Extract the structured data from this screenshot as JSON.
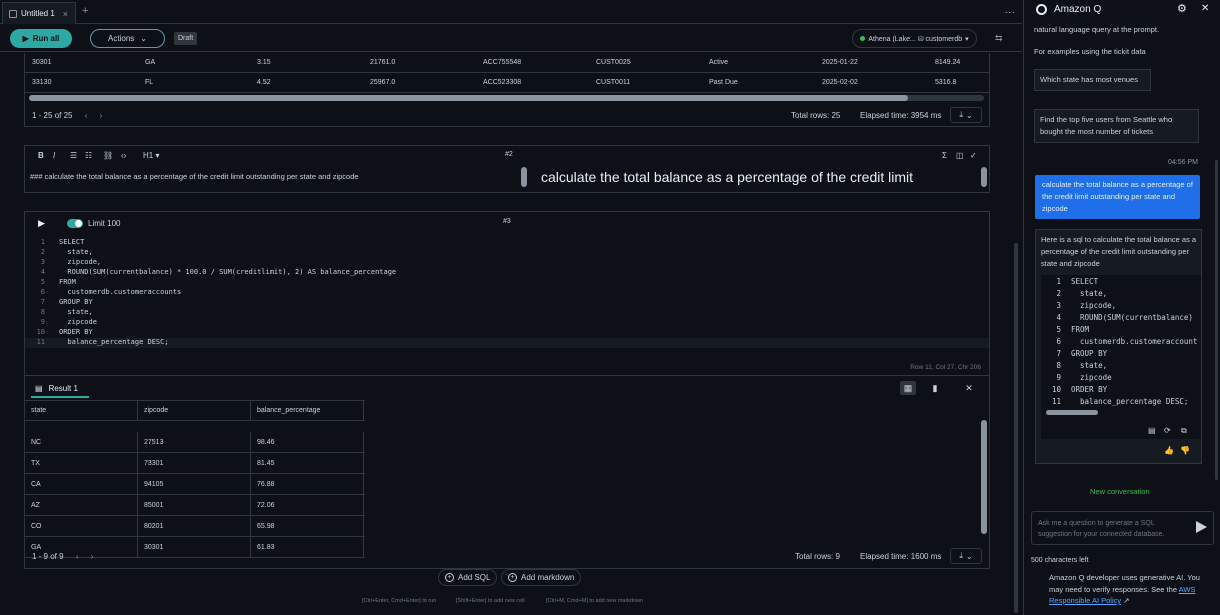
{
  "tab": {
    "title": "Untitled 1",
    "close": "×",
    "new": "+"
  },
  "window_menu": "...",
  "toolbar": {
    "run_all": "Run all",
    "actions": "Actions",
    "draft": "Draft",
    "db_label": "Athena (Lake... ⛁ customerdb",
    "collapse": "⇆"
  },
  "cell1": {
    "rows": [
      [
        "30301",
        "GA",
        "3.15",
        "21761.0",
        "ACC755548",
        "CUST0025",
        "Active",
        "2025-01-22",
        "8149.24"
      ],
      [
        "33130",
        "FL",
        "4.52",
        "25967.0",
        "ACC523308",
        "CUST0011",
        "Past Due",
        "2025-02-02",
        "5316.8"
      ]
    ],
    "pager": "1 - 25 of 25",
    "total_rows": "Total rows: 25",
    "elapsed": "Elapsed time: 3954 ms"
  },
  "cell2": {
    "toolbar": [
      "B",
      "I",
      "☰",
      "☷",
      "⛓",
      "‹›",
      "H1 ▾"
    ],
    "number": "#2",
    "right_tools": [
      "Σ",
      "◫",
      "✓"
    ],
    "source": "### calculate the total balance as a percentage of the credit limit outstanding per state and zipcode",
    "rendered": "calculate the total balance as a percentage of the credit limit"
  },
  "cell3": {
    "number": "#3",
    "limit": "Limit 100",
    "code": [
      "SELECT",
      "  state,",
      "  zipcode,",
      "  ROUND(SUM(currentbalance) * 100.0 / SUM(creditlimit), 2) AS balance_percentage",
      "FROM",
      "  customerdb.customeraccounts",
      "GROUP BY",
      "  state,",
      "  zipcode",
      "ORDER BY",
      "  balance_percentage DESC;"
    ],
    "cursor": "Row 11,  Col 27,  Chr 206",
    "result": {
      "tab": "Result 1",
      "columns": [
        "state",
        "zipcode",
        "balance_percentage"
      ],
      "rows": [
        [
          "NC",
          "27513",
          "98.46"
        ],
        [
          "TX",
          "73301",
          "81.45"
        ],
        [
          "CA",
          "94105",
          "76.88"
        ],
        [
          "AZ",
          "85001",
          "72.06"
        ],
        [
          "CO",
          "80201",
          "65.98"
        ],
        [
          "GA",
          "30301",
          "61.83"
        ]
      ],
      "pager": "1 - 9 of 9",
      "total_rows": "Total rows: 9",
      "elapsed": "Elapsed time: 1600 ms"
    }
  },
  "add": {
    "sql": "Add SQL",
    "markdown": "Add markdown"
  },
  "shortcuts": [
    "[Ctrl+Enter, Cmd+Enter] to run",
    "[Shift+Enter] to add new cell",
    "[Ctrl+M, Cmd+M] to add new markdown"
  ],
  "q": {
    "title": "Amazon Q",
    "top_text": "natural language query at the prompt.",
    "examples_label": "For examples using the tickit data",
    "suggestions": [
      "Which state has most venues",
      "Find the top five users from Seattle who bought the most number of tickets"
    ],
    "time": "04:56 PM",
    "user_msg": "calculate the total balance as a percentage of the credit limit outstanding per state and zipcode",
    "response_intro": "Here is a sql to calculate the total balance as a percentage of the credit limit outstanding per state and zipcode",
    "code": [
      "SELECT",
      "  state,",
      "  zipcode,",
      "  ROUND(SUM(currentbalance)",
      "FROM",
      "  customerdb.customeraccount",
      "GROUP BY",
      "  state,",
      "  zipcode",
      "ORDER BY",
      "  balance_percentage DESC;"
    ],
    "new_conversation": "New conversation",
    "input_placeholder": "Ask me a question to generate a SQL suggestion for your connected database.",
    "chars_left": "500 characters left",
    "disclaimer": "Amazon Q developer uses generative AI. You may need to verify responses. See the",
    "policy_link": "AWS Responsible AI Policy"
  }
}
